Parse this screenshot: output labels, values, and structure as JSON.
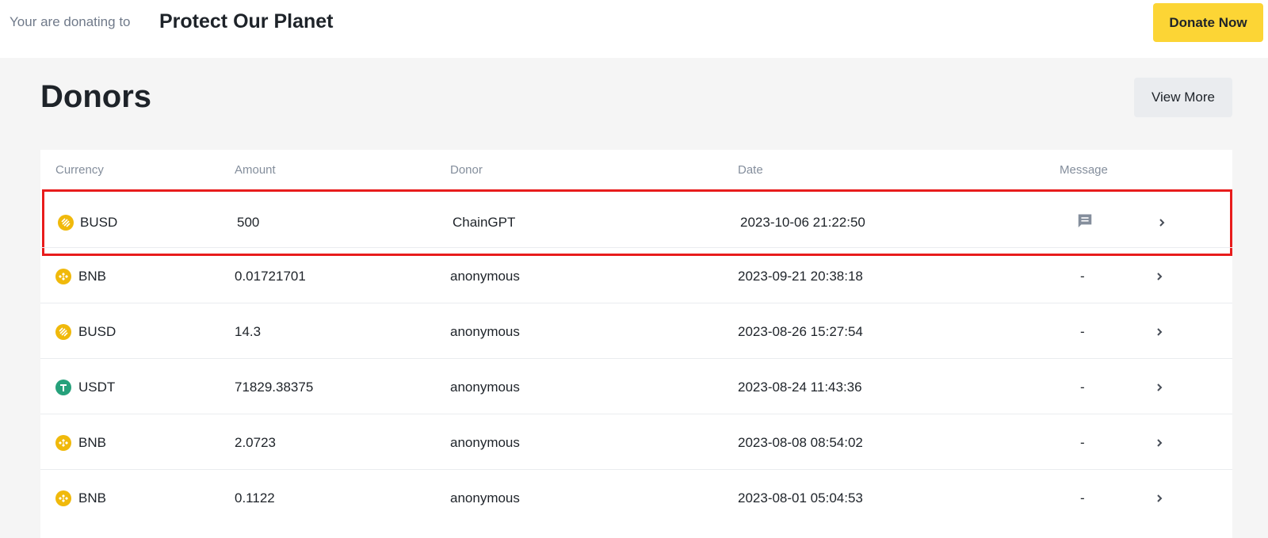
{
  "topbar": {
    "prefix": "Your are donating to",
    "campaign": "Protect Our Planet",
    "donate_label": "Donate Now"
  },
  "section": {
    "title": "Donors",
    "view_more_label": "View More"
  },
  "table": {
    "headers": [
      "Currency",
      "Amount",
      "Donor",
      "Date",
      "Message"
    ],
    "rows": [
      {
        "currency": "BUSD",
        "icon": "busd-icon",
        "amount": "500",
        "donor": "ChainGPT",
        "date": "2023-10-06 21:22:50",
        "message": "message-icon",
        "highlighted": true
      },
      {
        "currency": "BNB",
        "icon": "bnb-icon",
        "amount": "0.01721701",
        "donor": "anonymous",
        "date": "2023-09-21 20:38:18",
        "message": "-"
      },
      {
        "currency": "BUSD",
        "icon": "busd-icon",
        "amount": "14.3",
        "donor": "anonymous",
        "date": "2023-08-26 15:27:54",
        "message": "-"
      },
      {
        "currency": "USDT",
        "icon": "usdt-icon",
        "amount": "71829.38375",
        "donor": "anonymous",
        "date": "2023-08-24 11:43:36",
        "message": "-"
      },
      {
        "currency": "BNB",
        "icon": "bnb-icon",
        "amount": "2.0723",
        "donor": "anonymous",
        "date": "2023-08-08 08:54:02",
        "message": "-"
      },
      {
        "currency": "BNB",
        "icon": "bnb-icon",
        "amount": "0.1122",
        "donor": "anonymous",
        "date": "2023-08-01 05:04:53",
        "message": "-"
      }
    ]
  },
  "colors": {
    "accent": "#fcd535",
    "highlight_border": "#e81c1c",
    "usdt": "#26a17b",
    "bnb": "#f0b90b"
  }
}
